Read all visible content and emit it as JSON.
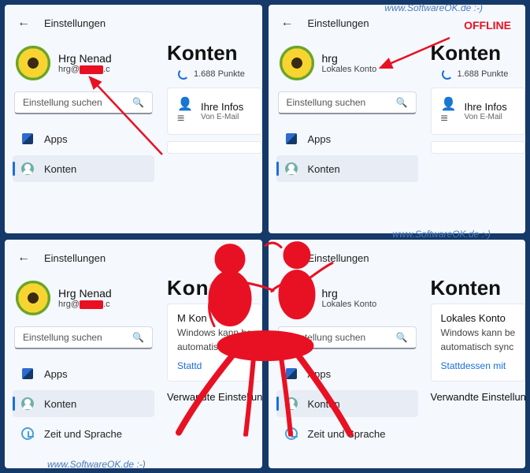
{
  "watermarks": {
    "top": "www.SoftwareOK.de :-)",
    "mid": "www.SoftwareOK.de :-)",
    "bottom": "www.SoftwareOK.de :-)"
  },
  "offline_label": "OFFLINE",
  "common": {
    "settings_title": "Einstellungen",
    "search_placeholder": "Einstellung suchen",
    "nav_apps": "Apps",
    "nav_accounts": "Konten",
    "nav_time": "Zeit und Sprache",
    "page_heading": "Konten",
    "points": "1.688 Punkte",
    "info_title": "Ihre Infos",
    "info_sub": "Von E-Mail",
    "your_account_sub": "Windows kann be",
    "your_account_sub2": "automatisch sync",
    "instead_link": "Stattdessen mit",
    "instead_link_short": "Stattd",
    "related_settings": "Verwandte Einstellungen",
    "local_account_title": "Lokales Konto",
    "ms_account_title_partial": "M            Kon"
  },
  "panels": [
    {
      "user_name": "Hrg Nenad",
      "user_sub_prefix": "hrg@",
      "user_sub_redacted": true,
      "user_sub_suffix": ".c"
    },
    {
      "user_name": "hrg",
      "user_sub": "Lokales Konto"
    },
    {
      "user_name": "Hrg Nenad",
      "user_sub_prefix": "hrg@",
      "user_sub_redacted": true,
      "user_sub_suffix": ".c"
    },
    {
      "user_name": "hrg",
      "user_sub": "Lokales Konto"
    }
  ]
}
